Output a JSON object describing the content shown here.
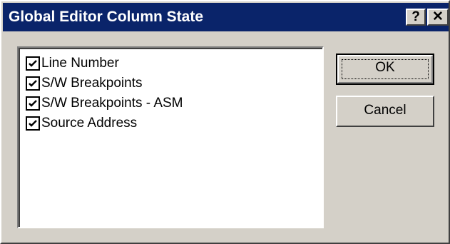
{
  "dialog": {
    "title": "Global Editor Column State",
    "help_glyph": "?",
    "close_glyph": "✕"
  },
  "columns": {
    "items": [
      {
        "label": "Line Number",
        "checked": true
      },
      {
        "label": "S/W Breakpoints",
        "checked": true
      },
      {
        "label": "S/W Breakpoints - ASM",
        "checked": true
      },
      {
        "label": "Source Address",
        "checked": true
      }
    ]
  },
  "buttons": {
    "ok_label": "OK",
    "cancel_label": "Cancel"
  },
  "colors": {
    "titlebar": "#0a246a",
    "face": "#d4d0c8"
  }
}
